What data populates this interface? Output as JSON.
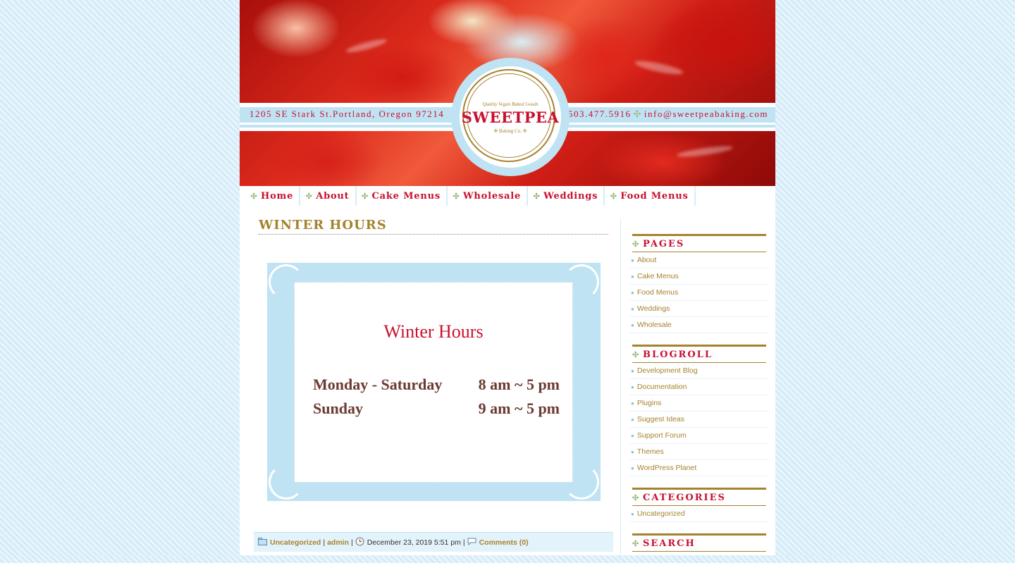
{
  "header": {
    "address": "1205 SE Stark St.Portland, Oregon 97214",
    "phone": "503.477.5916",
    "email": "info@sweetpeabaking.com",
    "logo": {
      "tagline": "Quality Vegan Baked Goods",
      "name": "SWEETPEA",
      "sub": "✣ Baking Co. ✣"
    }
  },
  "nav": {
    "items": [
      {
        "label": "Home"
      },
      {
        "label": "About"
      },
      {
        "label": "Cake Menus"
      },
      {
        "label": "Wholesale"
      },
      {
        "label": "Weddings"
      },
      {
        "label": "Food Menus"
      }
    ]
  },
  "post": {
    "title": "WINTER HOURS",
    "image": {
      "heading": "Winter Hours",
      "rows": [
        {
          "days": "Monday - Saturday",
          "hours": "8 am ~ 5 pm"
        },
        {
          "days": "Sunday",
          "hours": "9 am ~ 5 pm"
        }
      ]
    },
    "meta": {
      "category": "Uncategorized",
      "author": "admin",
      "date": "December 23, 2019 5:51 pm",
      "comments": "Comments (0)"
    }
  },
  "sidebar": {
    "pages": {
      "title": "PAGES",
      "items": [
        "About",
        "Cake Menus",
        "Food Menus",
        "Weddings",
        "Wholesale"
      ]
    },
    "blogroll": {
      "title": "BLOGROLL",
      "items": [
        "Development Blog",
        "Documentation",
        "Plugins",
        "Suggest Ideas",
        "Support Forum",
        "Themes",
        "WordPress Planet"
      ]
    },
    "categories": {
      "title": "CATEGORIES",
      "items": [
        "Uncategorized"
      ]
    },
    "search": {
      "title": "SEARCH"
    }
  },
  "colors": {
    "brand_red": "#c8102e",
    "gold": "#a5832e",
    "light_blue": "#bfe3f3"
  }
}
